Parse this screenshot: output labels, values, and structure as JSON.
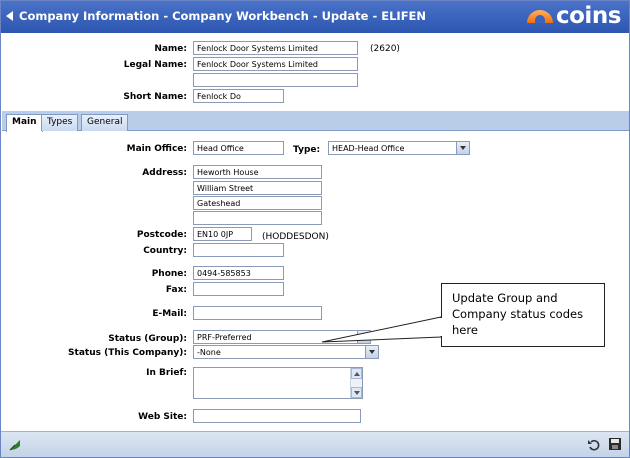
{
  "window": {
    "title": "Company Information - Company Workbench - Update - ELIFEN",
    "logo_text": "coins"
  },
  "header_fields": {
    "name_label": "Name:",
    "name_value": "Fenlock Door Systems Limited",
    "company_code": "(2620)",
    "legal_name_label": "Legal Name:",
    "legal_name_value": "Fenlock Door Systems Limited",
    "legal_name_line2": "",
    "short_name_label": "Short Name:",
    "short_name_value": "Fenlock Do"
  },
  "tabs": [
    {
      "label": "Main",
      "active": true
    },
    {
      "label": "Types",
      "active": false
    },
    {
      "label": "General",
      "active": false
    }
  ],
  "main": {
    "main_office_label": "Main Office:",
    "main_office_value": "Head Office",
    "type_label": "Type:",
    "type_value": "HEAD-Head Office",
    "address_label": "Address:",
    "address_lines": [
      "Heworth House",
      "William Street",
      "Gateshead",
      ""
    ],
    "postcode_label": "Postcode:",
    "postcode_value": "EN10 0JP",
    "postcode_lookup": "(HODDESDON)",
    "country_label": "Country:",
    "country_value": "",
    "phone_label": "Phone:",
    "phone_value": "0494-585853",
    "fax_label": "Fax:",
    "fax_value": "",
    "email_label": "E-Mail:",
    "email_value": "",
    "status_group_label": "Status (Group):",
    "status_group_value": "PRF-Preferred",
    "status_company_label": "Status (This Company):",
    "status_company_value": "-None",
    "in_brief_label": "In Brief:",
    "in_brief_value": "",
    "website_label": "Web Site:",
    "website_value": ""
  },
  "callout": {
    "text": "Update Group and Company status codes here"
  },
  "colors": {
    "title_bar": "#2c56b0",
    "tab_strip": "#b9cde8",
    "logo_accent": "#f07010"
  }
}
